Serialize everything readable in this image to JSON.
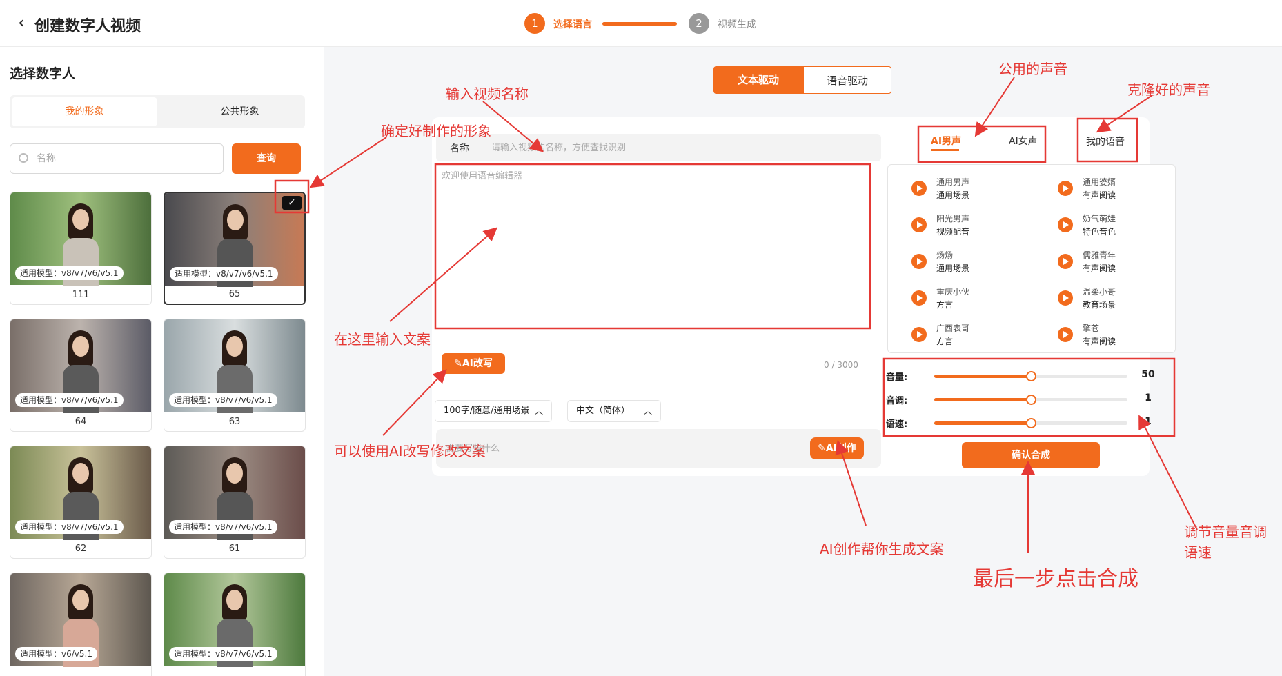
{
  "header": {
    "title": "创建数字人视频",
    "steps": [
      {
        "number": "1",
        "label": "选择语言",
        "active": true
      },
      {
        "number": "2",
        "label": "视频生成",
        "active": false
      }
    ]
  },
  "sidebar": {
    "title": "选择数字人",
    "tabs": [
      {
        "label": "我的形象"
      },
      {
        "label": "公共形象"
      }
    ],
    "search": {
      "placeholder": "名称",
      "button": "查询"
    },
    "cards": [
      {
        "model": "适用模型：v8/v7/v6/v5.1",
        "name": "111",
        "selected": false
      },
      {
        "model": "适用模型：v8/v7/v6/v5.1",
        "name": "65",
        "selected": true
      },
      {
        "model": "适用模型：v8/v7/v6/v5.1",
        "name": "64",
        "selected": false
      },
      {
        "model": "适用模型：v8/v7/v6/v5.1",
        "name": "63",
        "selected": false
      },
      {
        "model": "适用模型：v8/v7/v6/v5.1",
        "name": "62",
        "selected": false
      },
      {
        "model": "适用模型：v8/v7/v6/v5.1",
        "name": "61",
        "selected": false
      },
      {
        "model": "适用模型：v6/v5.1",
        "name": "",
        "selected": false
      },
      {
        "model": "适用模型：v8/v7/v6/v5.1",
        "name": "",
        "selected": false
      }
    ]
  },
  "main": {
    "mode_tabs": [
      {
        "label": "文本驱动"
      },
      {
        "label": "语音驱动"
      }
    ],
    "editor": {
      "name_label": "名称",
      "name_placeholder": "请输入视频的名称，方便查找识别",
      "text_placeholder": "欢迎使用语音编辑器",
      "ai_rewrite": "AI改写",
      "counter": "0 / 3000",
      "dropdown_length": "100字/随意/通用场景",
      "dropdown_language": "中文（简体）",
      "prompt_placeholder": "需要写些什么",
      "ai_create": "AI创作"
    },
    "voice": {
      "tabs": [
        {
          "label": "AI男声"
        },
        {
          "label": "AI女声"
        },
        {
          "label": "我的语音"
        }
      ],
      "items": [
        {
          "name": "通用男声",
          "tag": "通用场景"
        },
        {
          "name": "通用婆婿",
          "tag": "有声阅读"
        },
        {
          "name": "阳光男声",
          "tag": "视频配音"
        },
        {
          "name": "奶气萌娃",
          "tag": "特色音色"
        },
        {
          "name": "炀炀",
          "tag": "通用场景"
        },
        {
          "name": "儒雅青年",
          "tag": "有声阅读"
        },
        {
          "name": "重庆小伙",
          "tag": "方言"
        },
        {
          "name": "温柔小哥",
          "tag": "教育场景"
        },
        {
          "name": "广西表哥",
          "tag": "方言"
        },
        {
          "name": "擎苍",
          "tag": "有声阅读"
        }
      ],
      "sliders": [
        {
          "label": "音量:",
          "value": "50",
          "level": 0.5
        },
        {
          "label": "音调:",
          "value": "1",
          "level": 0.5
        },
        {
          "label": "语速:",
          "value": "1",
          "level": 0.5
        }
      ],
      "confirm": "确认合成"
    }
  },
  "annotations": {
    "select_figure": "确定好制作的形象",
    "input_name": "输入视频名称",
    "input_text": "在这里输入文案",
    "ai_rewrite": "可以使用AI改写修改文案",
    "public_voice": "公用的声音",
    "cloned_voice": "克隆好的声音",
    "ai_create": "AI创作帮你生成文案",
    "final_step": "最后一步点击合成",
    "adjust": "调节音量音调语速"
  },
  "colors": {
    "accent": "#f26b1d",
    "annotation": "#e53935"
  }
}
